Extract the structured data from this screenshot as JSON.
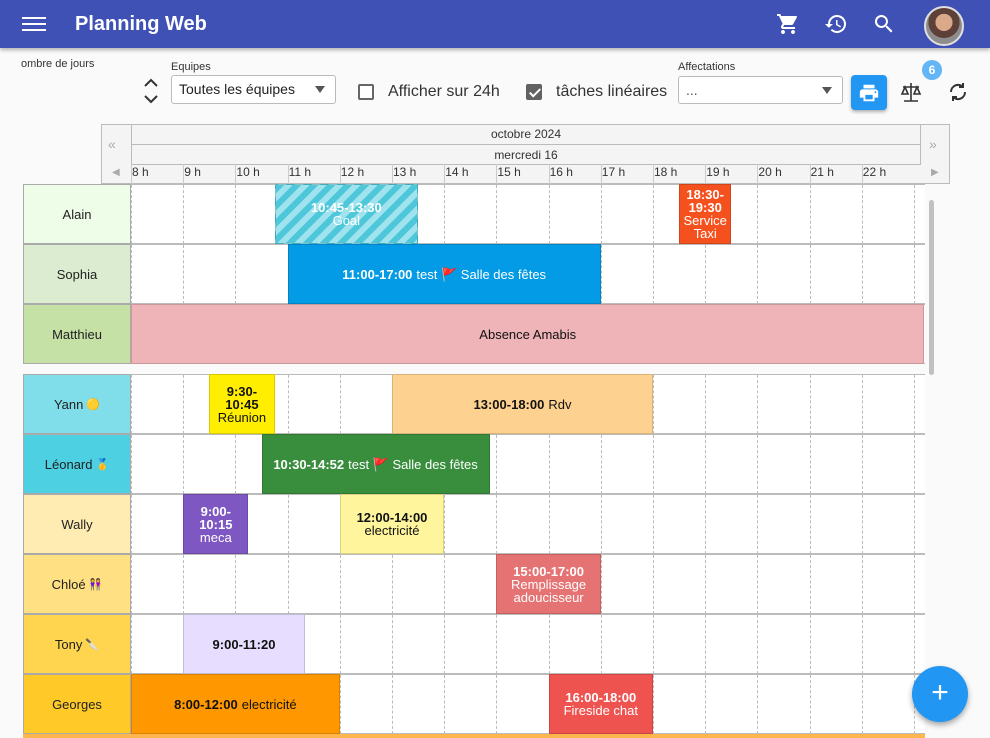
{
  "app": {
    "title": "Planning Web"
  },
  "toolbar": {
    "days_label": "ombre de jours",
    "teams_label": "Equipes",
    "teams_value": "Toutes les équipes",
    "show24_label": "Afficher sur 24h",
    "show24_checked": false,
    "linear_label": "tâches linéaires",
    "linear_checked": true,
    "assign_label": "Affectations",
    "assign_value": "...",
    "badge": "6"
  },
  "calendar": {
    "month": "octobre 2024",
    "day": "mercredi 16",
    "hours": [
      "8 h",
      "9 h",
      "10 h",
      "11 h",
      "12 h",
      "13 h",
      "14 h",
      "15 h",
      "16 h",
      "17 h",
      "18 h",
      "19 h",
      "20 h",
      "21 h",
      "22 h"
    ]
  },
  "rows": [
    {
      "name": "Alain",
      "emoji": ""
    },
    {
      "name": "Sophia",
      "emoji": ""
    },
    {
      "name": "Matthieu",
      "emoji": ""
    },
    {
      "name": "Yann",
      "emoji": "🟡"
    },
    {
      "name": "Léonard",
      "emoji": "🥇"
    },
    {
      "name": "Wally",
      "emoji": ""
    },
    {
      "name": "Chloé",
      "emoji": "👭"
    },
    {
      "name": "Tony",
      "emoji": "🔪"
    },
    {
      "name": "Georges",
      "emoji": ""
    }
  ],
  "events": [
    {
      "row": 0,
      "time": "10:45-13:30",
      "text": "Goal",
      "start": 10.75,
      "end": 13.5,
      "color": "#4dc7d9"
    },
    {
      "row": 0,
      "time": "18:30-19:30",
      "text": "Service Taxi",
      "start": 18.5,
      "end": 19.5,
      "color": "#f4511e"
    },
    {
      "row": 1,
      "time": "11:00-17:00",
      "text": "test 🚩 Salle des fêtes",
      "start": 11,
      "end": 17,
      "color": "#039be5"
    },
    {
      "row": 2,
      "time": "",
      "text": "Absence Amabis",
      "start": 8,
      "end": 23.2,
      "color": "#eeb4b8"
    },
    {
      "row": 3,
      "time": "9:30-10:45",
      "text": "Réunion",
      "start": 9.5,
      "end": 10.75,
      "color": "#ffee00"
    },
    {
      "row": 3,
      "time": "13:00-18:00",
      "text": "Rdv",
      "start": 13,
      "end": 18,
      "color": "#fdd291"
    },
    {
      "row": 4,
      "time": "10:30-14:52",
      "text": "test 🚩 Salle des fêtes",
      "start": 10.5,
      "end": 14.87,
      "color": "#388e3c"
    },
    {
      "row": 5,
      "time": "9:00-10:15",
      "text": "meca",
      "start": 9,
      "end": 10.25,
      "color": "#7e57c2"
    },
    {
      "row": 5,
      "time": "12:00-14:00",
      "text": "electricité",
      "start": 12,
      "end": 14,
      "color": "#fff59d"
    },
    {
      "row": 6,
      "time": "15:00-17:00",
      "text": "Remplissage adoucisseur",
      "start": 15,
      "end": 17,
      "color": "#e57373"
    },
    {
      "row": 7,
      "time": "9:00-11:20",
      "text": "",
      "start": 9,
      "end": 11.33,
      "color": "#e6ddff"
    },
    {
      "row": 8,
      "time": "8:00-12:00",
      "text": "electricité",
      "start": 8,
      "end": 12,
      "color": "#ff9800"
    },
    {
      "row": 8,
      "time": "16:00-18:00",
      "text": "Fireside chat",
      "start": 16,
      "end": 18,
      "color": "#ef5350"
    }
  ],
  "icons": {
    "menu": "menu-icon",
    "cart": "cart-icon",
    "history": "history-icon",
    "search": "search-icon",
    "print": "print-icon",
    "balance": "balance-icon",
    "refresh": "refresh-icon",
    "add": "add-icon"
  }
}
